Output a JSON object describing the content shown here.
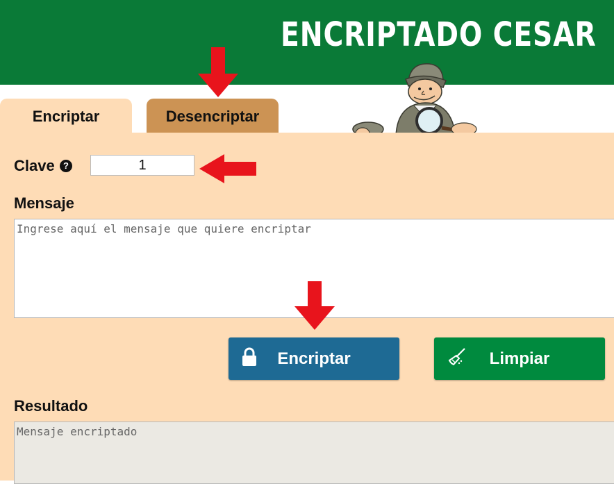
{
  "header": {
    "title": "ENCRIPTADO CESAR"
  },
  "tabs": [
    {
      "label": "Encriptar",
      "active": true
    },
    {
      "label": "Desencriptar",
      "active": false
    }
  ],
  "form": {
    "key_label": "Clave",
    "key_value": "1",
    "message_label": "Mensaje",
    "message_placeholder": "Ingrese aquí el mensaje que quiere encriptar",
    "result_label": "Resultado",
    "result_placeholder": "Mensaje encriptado"
  },
  "buttons": {
    "encrypt": {
      "label": "Encriptar",
      "icon": "lock-icon",
      "color": "#1e6a94"
    },
    "clear": {
      "label": "Limpiar",
      "icon": "broom-icon",
      "color": "#008a3e"
    }
  },
  "colors": {
    "header": "#0a7a37",
    "panel": "#fedcb6",
    "inactive_tab": "#cc9354",
    "arrow": "#e8141c"
  }
}
